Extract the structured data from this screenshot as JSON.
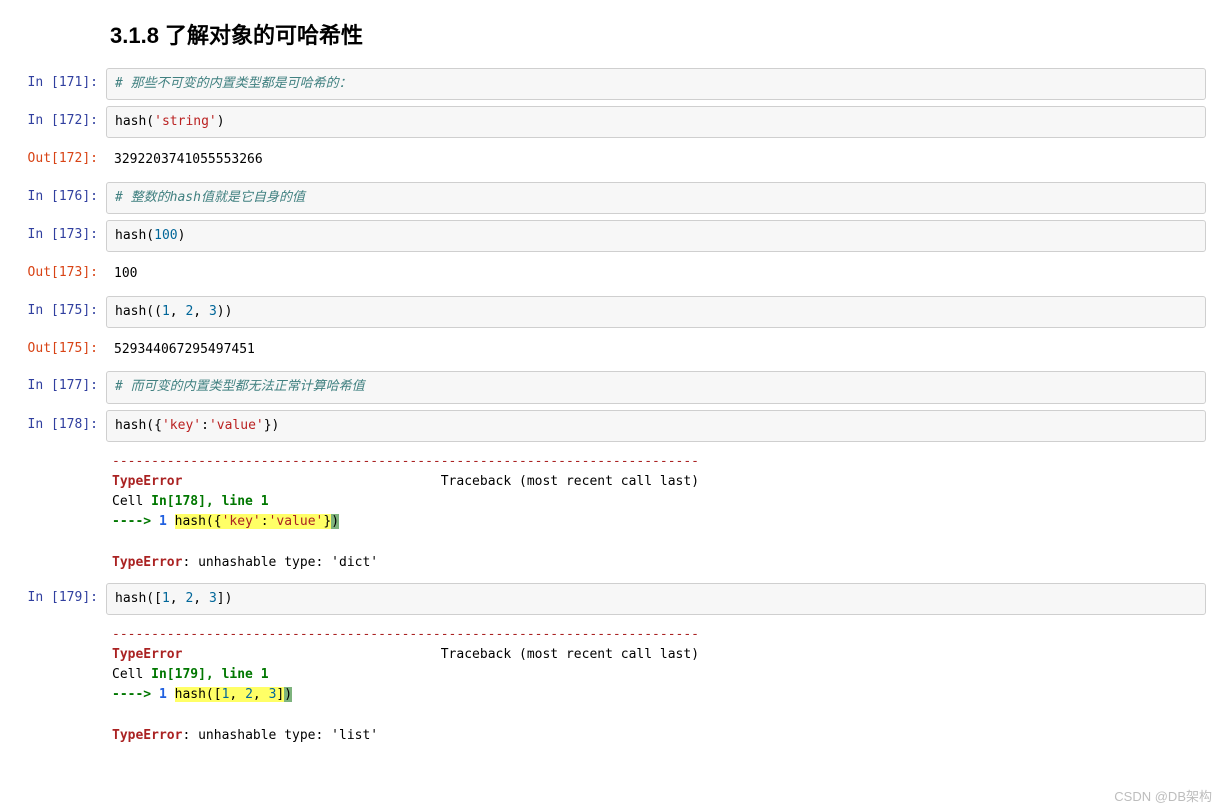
{
  "heading": "3.1.8 了解对象的可哈希性",
  "watermark": "CSDN @DB架构",
  "traceback_label": "Traceback (most recent call last)",
  "cells": {
    "c171": {
      "in_prompt": "In [171]:",
      "comment": "# 那些不可变的内置类型都是可哈希的："
    },
    "c172": {
      "in_prompt": "In [172]:",
      "out_prompt": "Out[172]:",
      "code_pre": "hash(",
      "code_str": "'string'",
      "code_post": ")",
      "output": "3292203741055553266"
    },
    "c176": {
      "in_prompt": "In [176]:",
      "comment": "# 整数的hash值就是它自身的值"
    },
    "c173": {
      "in_prompt": "In [173]:",
      "out_prompt": "Out[173]:",
      "code_pre": "hash(",
      "code_num": "100",
      "code_post": ")",
      "output": "100"
    },
    "c175": {
      "in_prompt": "In [175]:",
      "out_prompt": "Out[175]:",
      "code_pre": "hash((",
      "n1": "1",
      "n2": "2",
      "n3": "3",
      "code_post": "))",
      "output": "529344067295497451"
    },
    "c177": {
      "in_prompt": "In [177]:",
      "comment": "# 而可变的内置类型都无法正常计算哈希值"
    },
    "c178": {
      "in_prompt": "In [178]:",
      "code_pre": "hash({",
      "k": "'key'",
      "sep": ":",
      "v": "'value'",
      "code_post": "})",
      "dash": "---------------------------------------------------------------------------",
      "err": "TypeError",
      "cell_line_a": "Cell ",
      "cell_line_b": "In[178], line 1",
      "arrow": "----> ",
      "lineno": "1",
      "hl_pre": "hash({",
      "hl_k": "'key'",
      "hl_sep": ":",
      "hl_v": "'value'",
      "hl_close": "}",
      "hl_end": ")",
      "final_err": "TypeError",
      "final_msg": ": unhashable type: 'dict'"
    },
    "c179": {
      "in_prompt": "In [179]:",
      "code_pre": "hash([",
      "n1": "1",
      "n2": "2",
      "n3": "3",
      "code_post": "])",
      "dash": "---------------------------------------------------------------------------",
      "err": "TypeError",
      "cell_line_a": "Cell ",
      "cell_line_b": "In[179], line 1",
      "arrow": "----> ",
      "lineno": "1",
      "hl_pre": "hash([",
      "hl_n1": "1",
      "hl_n2": "2",
      "hl_n3": "3",
      "hl_close": "]",
      "hl_end": ")",
      "final_err": "TypeError",
      "final_msg": ": unhashable type: 'list'"
    }
  }
}
